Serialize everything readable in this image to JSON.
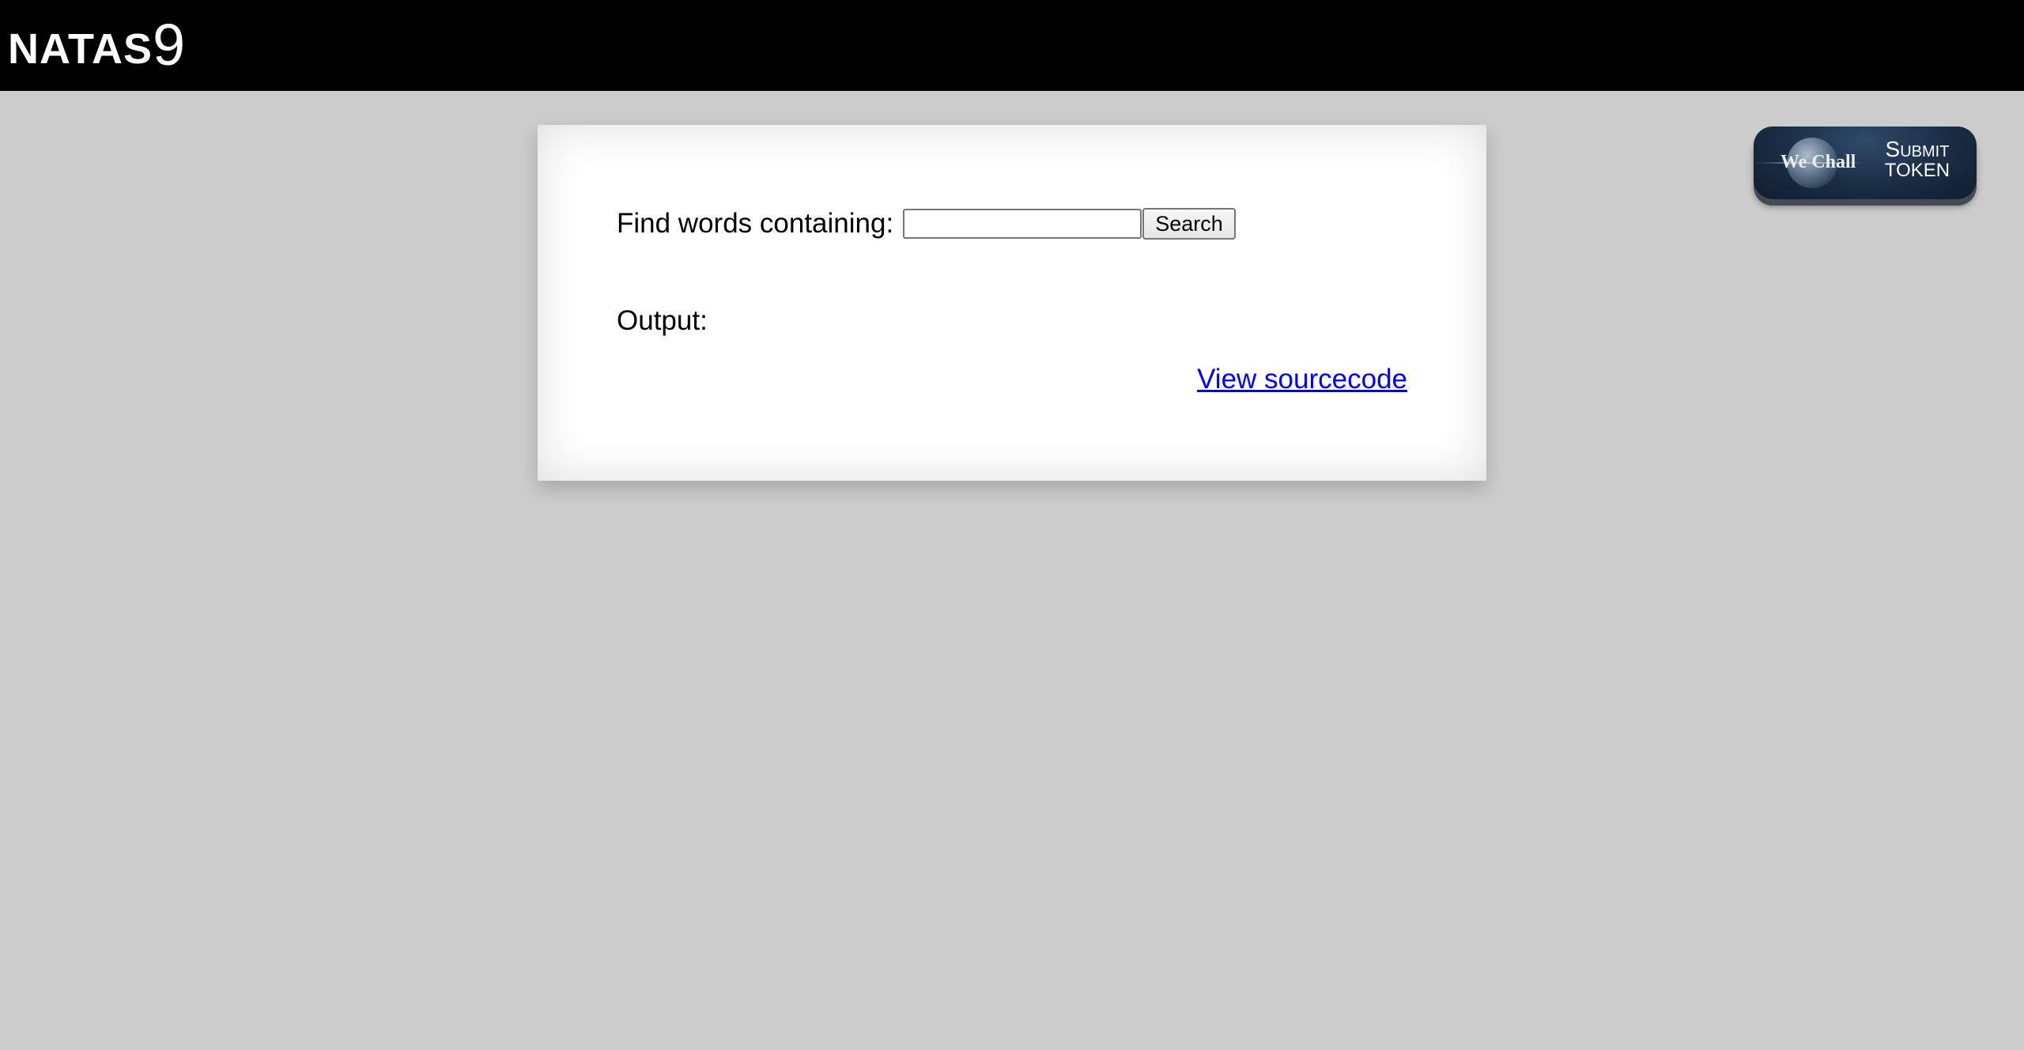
{
  "header": {
    "title_main": "NATAS",
    "title_num": "9"
  },
  "form": {
    "label": "Find words containing:",
    "input_value": "",
    "search_button": "Search"
  },
  "output": {
    "label": "Output:"
  },
  "links": {
    "view_source": "View sourcecode"
  },
  "badge": {
    "logo_text": "We Chall",
    "submit_line1": "Submit",
    "submit_line2": "TOKEN"
  },
  "colors": {
    "header_bg": "#000000",
    "page_bg": "#cccccc",
    "content_bg": "#ffffff",
    "link": "#0000ee",
    "badge_bg": "#1a2c44"
  }
}
